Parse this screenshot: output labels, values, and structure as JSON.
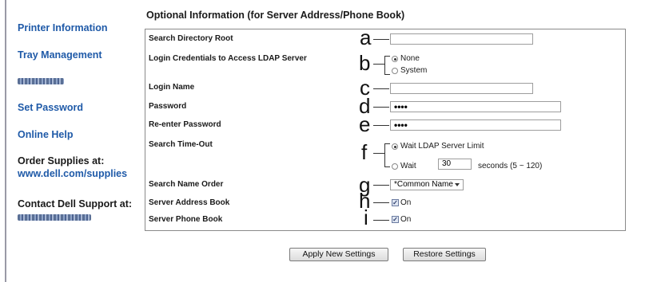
{
  "sidebar": {
    "printer_info": "Printer Information",
    "tray_mgmt": "Tray Management",
    "blurred_item": "Print Volume",
    "set_password": "Set Password",
    "online_help": "Online Help",
    "order_supplies_label": "Order Supplies at:",
    "order_supplies_url": "www.dell.com/supplies",
    "contact_label": "Contact Dell Support at:",
    "contact_url": "support.dell.com"
  },
  "section_title": "Optional Information (for Server Address/Phone Book)",
  "fields": {
    "search_root": {
      "label": "Search Directory Root",
      "letter": "a",
      "value": ""
    },
    "credentials": {
      "label": "Login Credentials to Access LDAP Server",
      "letter": "b",
      "options": [
        "None",
        "System"
      ],
      "selected": "None"
    },
    "login_name": {
      "label": "Login Name",
      "letter": "c",
      "value": ""
    },
    "password": {
      "label": "Password",
      "letter": "d",
      "value": "••••"
    },
    "reenter_password": {
      "label": "Re-enter Password",
      "letter": "e",
      "value": "••••"
    },
    "timeout": {
      "label": "Search Time-Out",
      "letter": "f",
      "option_limit": "Wait LDAP Server Limit",
      "option_wait": "Wait",
      "selected": "Wait LDAP Server Limit",
      "seconds_value": "30",
      "seconds_text": "seconds (5 ~ 120)"
    },
    "name_order": {
      "label": "Search Name Order",
      "letter": "g",
      "value": "*Common Name"
    },
    "address_book": {
      "label": "Server Address Book",
      "letter": "h",
      "checked": true,
      "text": "On"
    },
    "phone_book": {
      "label": "Server Phone Book",
      "letter": "i",
      "checked": true,
      "text": "On"
    }
  },
  "buttons": {
    "apply": "Apply New Settings",
    "restore": "Restore Settings"
  }
}
